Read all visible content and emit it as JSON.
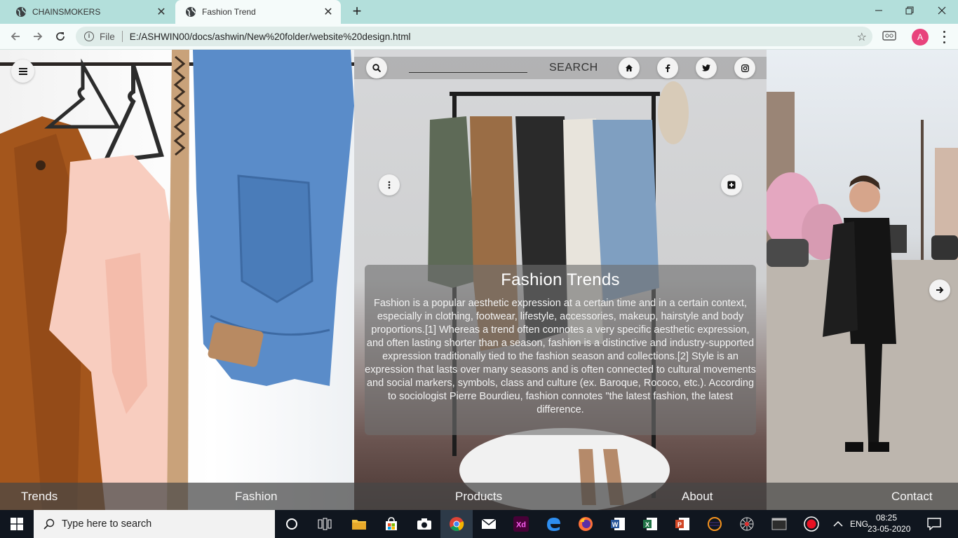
{
  "browser": {
    "tabs": [
      {
        "title": "CHAINSMOKERS",
        "active": false
      },
      {
        "title": "Fashion Trend",
        "active": true
      }
    ],
    "omnibox": {
      "scheme_label": "File",
      "url": "E:/ASHWIN00/docs/ashwin/New%20folder/website%20design.html"
    },
    "profile_initial": "A"
  },
  "page": {
    "search": {
      "label": "SEARCH"
    },
    "card": {
      "title": "Fashion Trends",
      "body": "Fashion is a popular aesthetic expression at a certain time and in a certain context, especially in clothing, footwear, lifestyle, accessories, makeup, hairstyle and body proportions.[1] Whereas a trend often connotes a very specific aesthetic expression, and often lasting shorter than a season, fashion is a distinctive and industry-supported expression traditionally tied to the fashion season and collections.[2] Style is an expression that lasts over many seasons and is often connected to cultural movements and social markers, symbols, class and culture (ex. Baroque, Rococo, etc.). According to sociologist Pierre Bourdieu, fashion connotes \"the latest fashion, the latest difference."
    },
    "nav": [
      "Trends",
      "Fashion",
      "Products",
      "About",
      "Contact"
    ]
  },
  "taskbar": {
    "search_placeholder": "Type here to search",
    "language": "ENG",
    "time": "08:25",
    "date": "23-05-2020"
  },
  "colors": {
    "tabbar": "#b3dfdb",
    "toolbar": "#f5fbfa",
    "taskbar": "#10161f",
    "avatar": "#e8437c"
  }
}
